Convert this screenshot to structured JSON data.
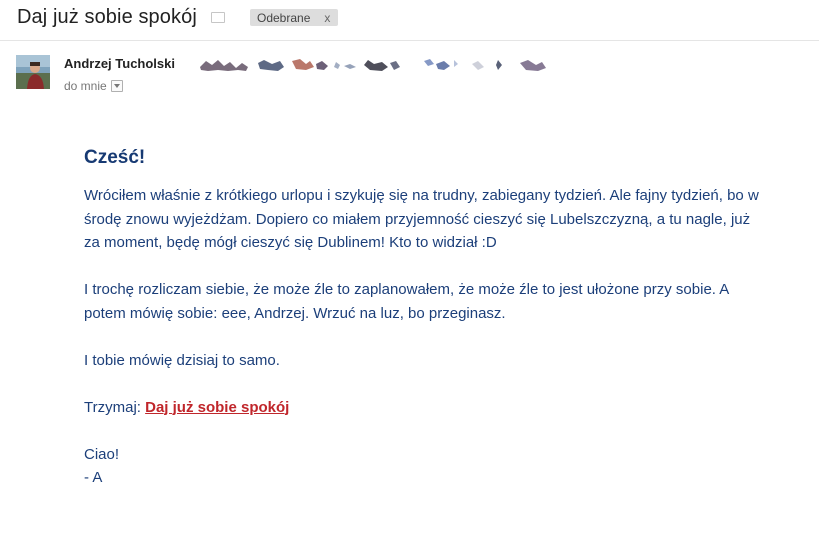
{
  "subject": "Daj już sobie spokój",
  "label_chip": {
    "text": "Odebrane",
    "close": "x"
  },
  "sender": {
    "name": "Andrzej Tucholski",
    "to_label": "do mnie"
  },
  "body": {
    "greeting": "Cześć!",
    "paragraph1": "Wróciłem właśnie z krótkiego urlopu i szykuję się na trudny, zabiegany tydzień. Ale fajny tydzień, bo w środę znowu wyjeżdżam. Dopiero co miałem przyjemność cieszyć się Lubelszczyzną, a tu nagle, już za moment, będę mógł cieszyć się Dublinem! Kto to widział :D",
    "paragraph2": "I trochę rozliczam siebie, że może źle to zaplanowałem, że może źle to jest ułożone przy sobie. A potem mówię sobie: eee, Andrzej. Wrzuć na luz, bo przeginasz.",
    "paragraph3": "I tobie mówię dzisiaj to samo.",
    "link_prefix": "Trzymaj:",
    "link_text": "Daj już sobie spokój",
    "closing": "Ciao!",
    "signature": "- A"
  },
  "colors": {
    "body_text": "#1c3f7a",
    "link": "#c0262b",
    "chip_bg": "#dddddd"
  }
}
